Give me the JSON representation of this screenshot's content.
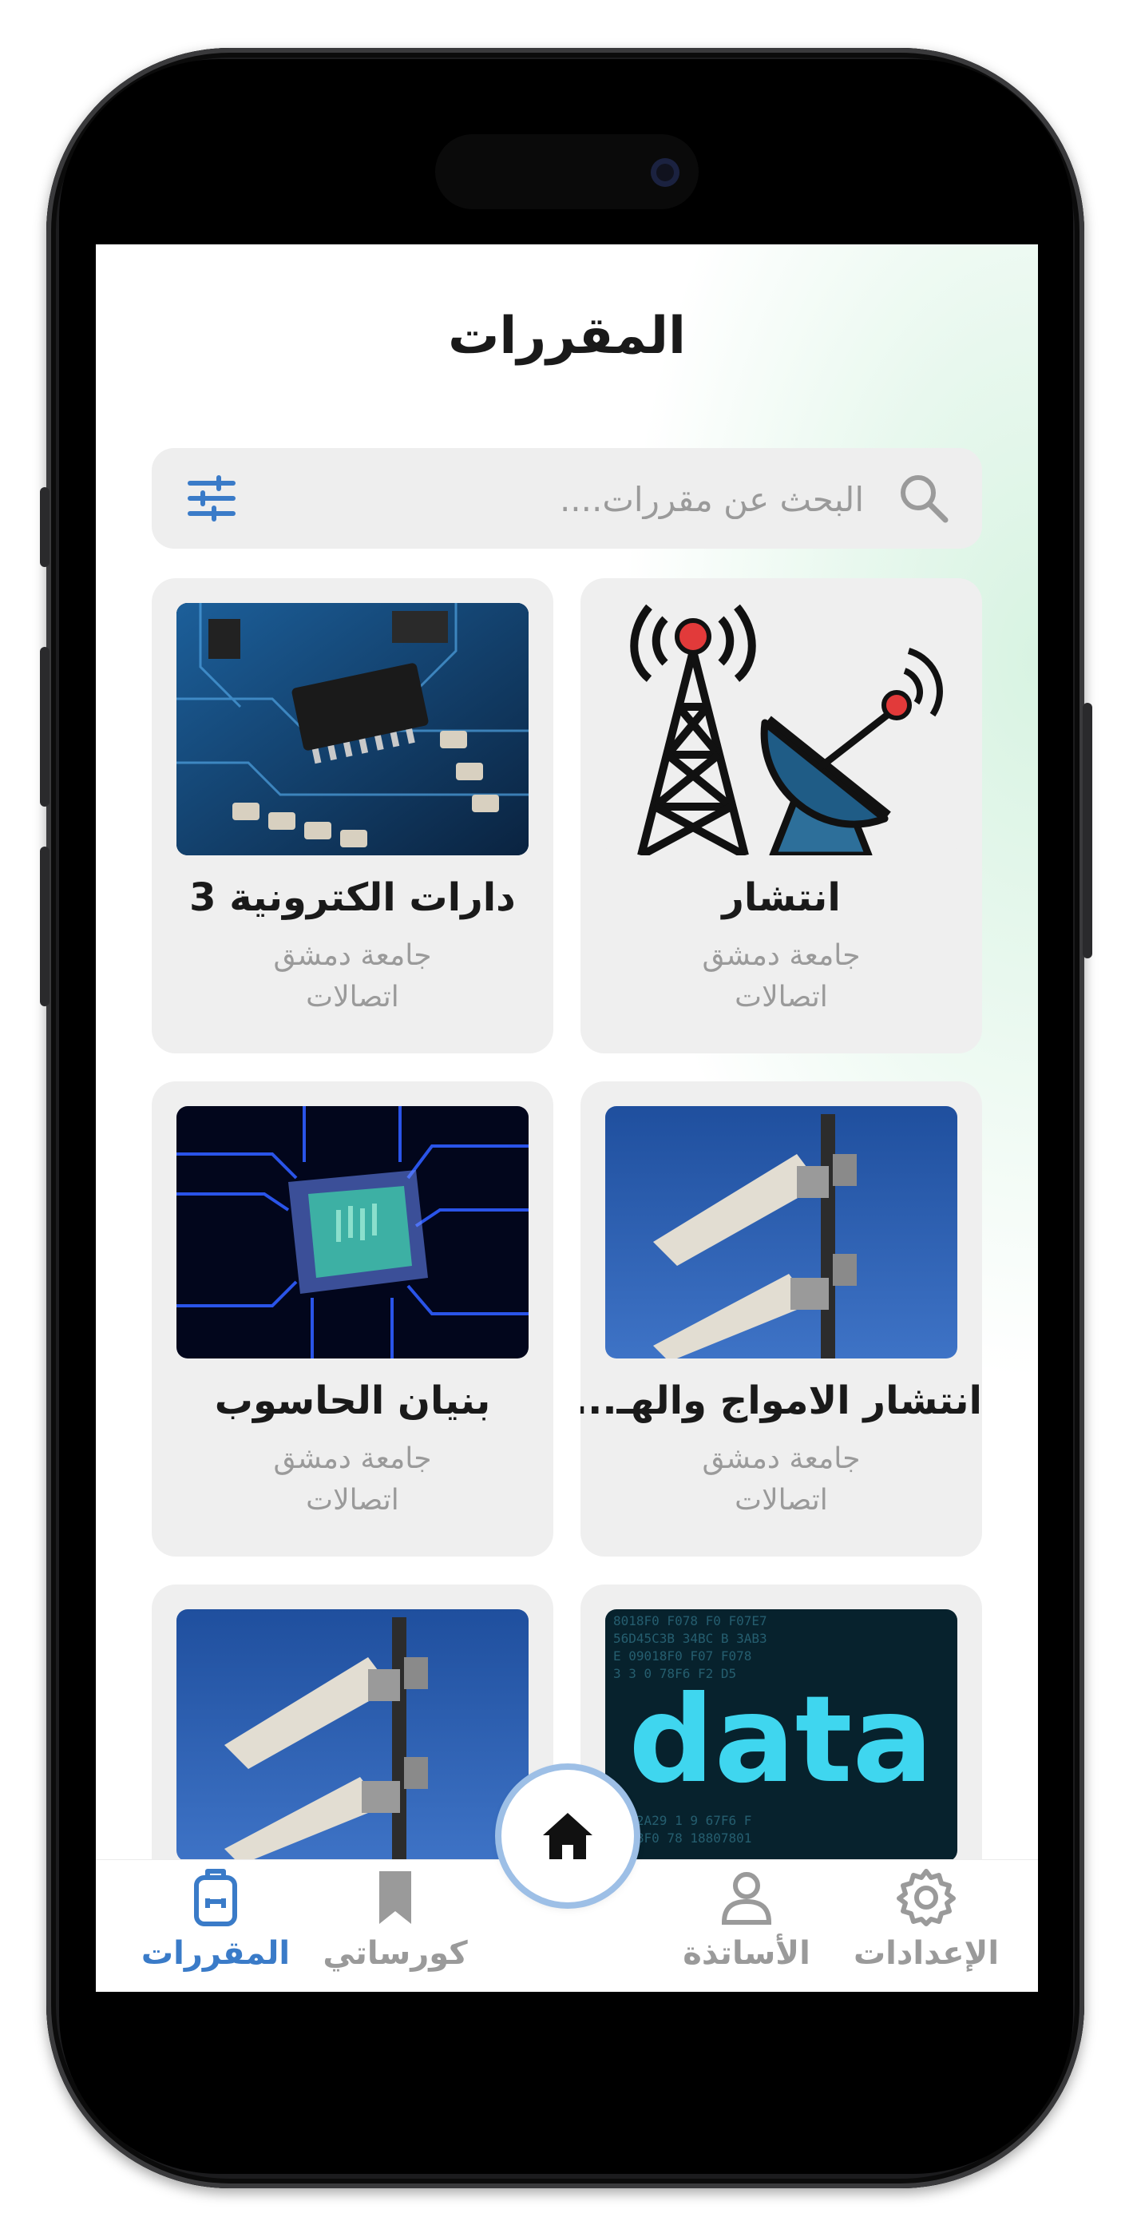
{
  "page_title": "المقررات",
  "search": {
    "placeholder": "البحث عن مقررات....",
    "icon": "search-icon",
    "filter_icon": "sliders-icon"
  },
  "courses": [
    {
      "name": "انتشار",
      "university": "جامعة دمشق",
      "department": "اتصالات",
      "image": "tower-and-satellite-dish"
    },
    {
      "name": "دارات الكترونية 3",
      "university": "جامعة دمشق",
      "department": "اتصالات",
      "image": "circuit-board-photo"
    },
    {
      "name": "انتشار الامواج والهـ...",
      "university": "جامعة دمشق",
      "department": "اتصالات",
      "image": "antenna-mast-photo"
    },
    {
      "name": "بنيان الحاسوب",
      "university": "جامعة دمشق",
      "department": "اتصالات",
      "image": "blue-cpu-chip-photo"
    },
    {
      "name": "",
      "university": "",
      "department": "",
      "image": "data-text-photo",
      "image_text": "data"
    },
    {
      "name": "",
      "university": "",
      "department": "",
      "image": "antenna-mast-photo"
    }
  ],
  "bottom_nav": {
    "items": [
      {
        "label": "الإعدادات",
        "icon": "gear-icon",
        "active": false
      },
      {
        "label": "الأساتذة",
        "icon": "person-icon",
        "active": false
      },
      {
        "label": "كورساتي",
        "icon": "bookmark-icon",
        "active": false
      },
      {
        "label": "المقررات",
        "icon": "backpack-icon",
        "active": true
      }
    ],
    "home_icon": "home-icon"
  },
  "colors": {
    "accent": "#3a7bc8",
    "card_bg": "#efefef",
    "muted_text": "#9a9a9a"
  }
}
